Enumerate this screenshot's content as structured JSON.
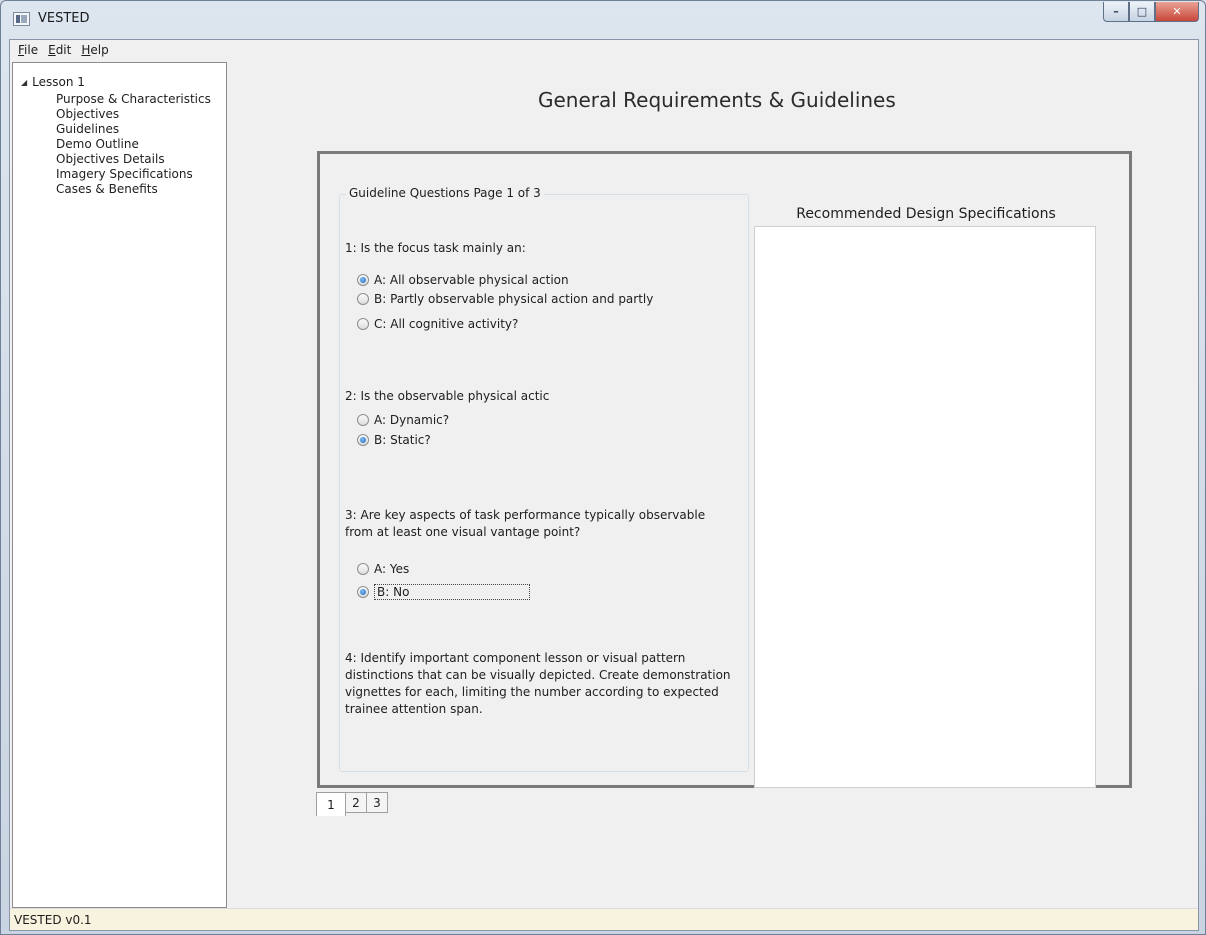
{
  "window": {
    "title": "VESTED"
  },
  "menu": [
    {
      "label": "File",
      "mnemonic": "F",
      "rest": "ile"
    },
    {
      "label": "Edit",
      "mnemonic": "E",
      "rest": "dit"
    },
    {
      "label": "Help",
      "mnemonic": "H",
      "rest": "elp"
    }
  ],
  "tree": {
    "root": "Lesson 1",
    "children": [
      "Purpose & Characteristics",
      "Objectives",
      "Guidelines",
      "Demo Outline",
      "Objectives Details",
      "Imagery Specifications",
      "Cases & Benefits"
    ]
  },
  "page_title": "General Requirements & Guidelines",
  "guidelines": {
    "legend": "Guideline Questions Page 1 of 3",
    "q1": {
      "text": "1: Is the focus task mainly an:",
      "options": [
        {
          "label": "A: All observable physical action",
          "checked": true
        },
        {
          "label": "B: Partly observable physical action and partly",
          "checked": false
        },
        {
          "label": "C: All cognitive activity?",
          "checked": false
        }
      ]
    },
    "q2": {
      "text": "2: Is the observable physical actic",
      "options": [
        {
          "label": "A: Dynamic?",
          "checked": false
        },
        {
          "label": "B: Static?",
          "checked": true
        }
      ]
    },
    "q3": {
      "text_line1": "3: Are key aspects of task performance typically observable",
      "text_line2": "from at least one visual vantage point?",
      "options": [
        {
          "label": "A: Yes",
          "checked": false
        },
        {
          "label": "B: No",
          "checked": true
        }
      ]
    },
    "q4": {
      "lines": [
        "4: Identify important component lesson or visual pattern",
        "distinctions that can be visually depicted. Create demonstration",
        "vignettes for each, limiting the number according to expected",
        "trainee attention span."
      ]
    }
  },
  "spec_title": "Recommended Design Specifications",
  "pager": [
    "1",
    "2",
    "3"
  ],
  "status": "VESTED v0.1"
}
